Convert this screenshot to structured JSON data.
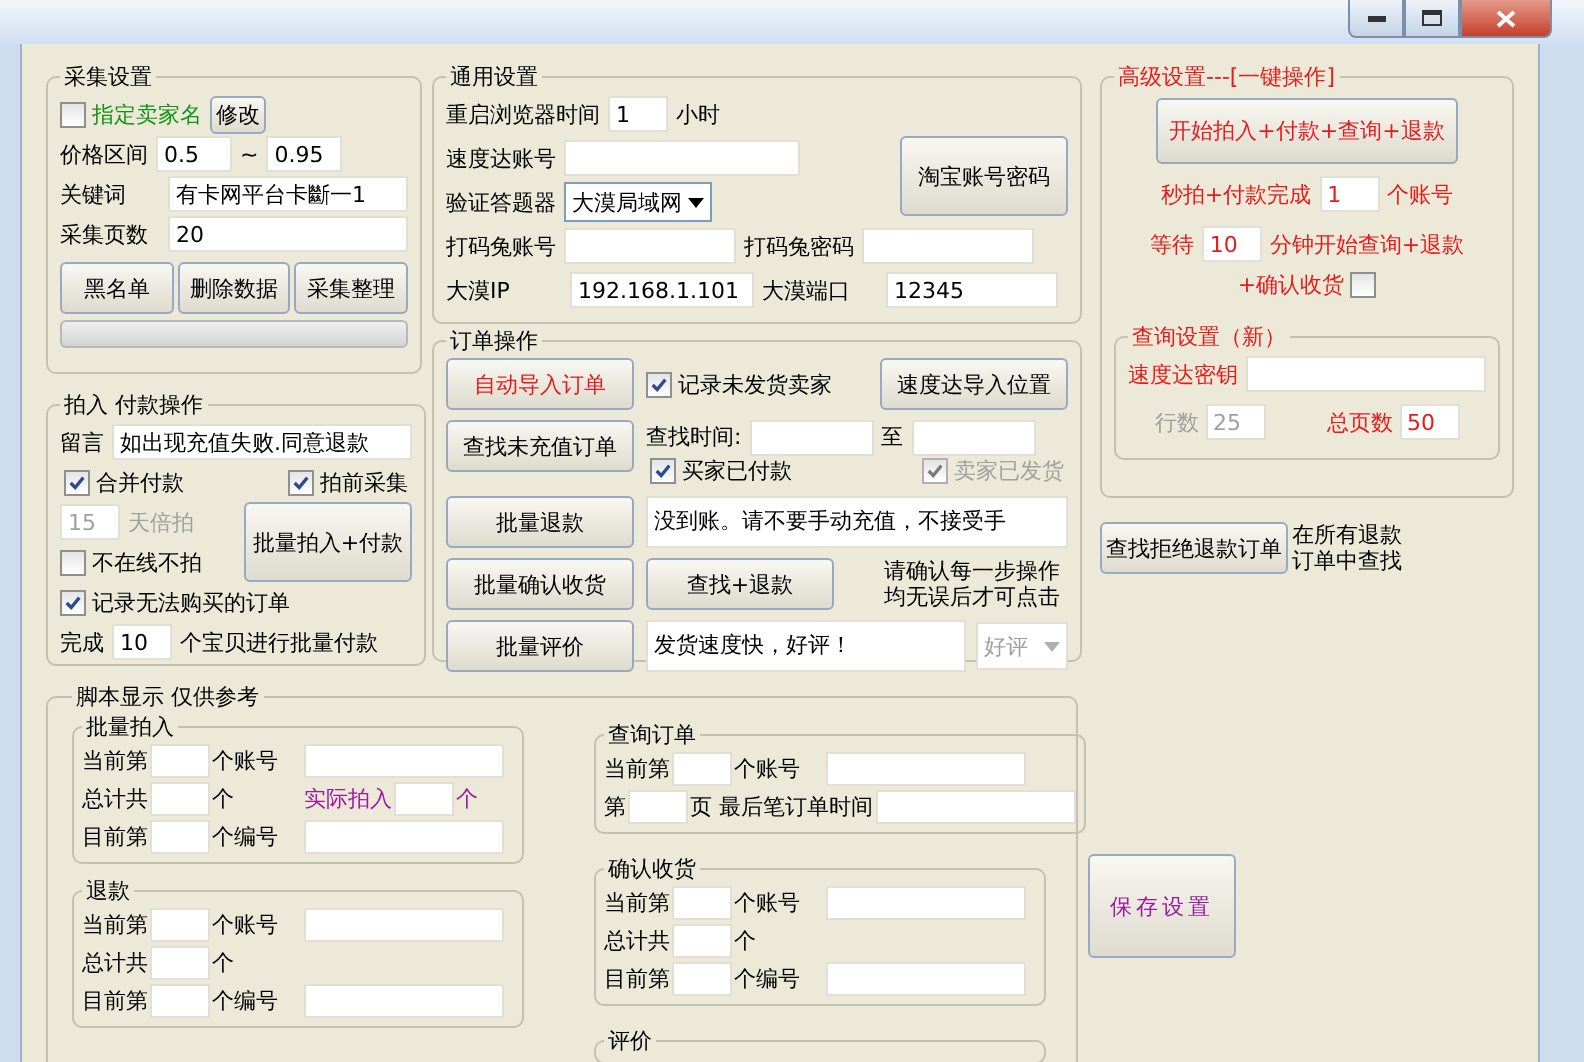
{
  "collect_settings": {
    "title": "采集设置",
    "seller_name": {
      "label": "指定卖家名",
      "checked": false
    },
    "modify_button": "修改",
    "price_label": "价格区间",
    "price_min": "0.5",
    "price_sep": "~",
    "price_max": "0.95",
    "keyword_label": "关键词",
    "keyword": "有卡网平台卡斷一1",
    "pages_label": "采集页数",
    "pages": "20",
    "buttons": [
      "黑名单",
      "删除数据",
      "采集整理"
    ],
    "progress": {
      "level": 0
    }
  },
  "buy_pay": {
    "title": "拍入 付款操作",
    "message_label": "留言",
    "message": "如出现充值失败.同意退款",
    "merge_pay": {
      "label": "合并付款",
      "checked": true
    },
    "pre_collect": {
      "label": "拍前采集",
      "checked": true
    },
    "days": {
      "value": "15",
      "label": "天倍拍",
      "disabled": true
    },
    "offline": {
      "label": "不在线不拍",
      "checked": false
    },
    "batch_button": "批量拍入+付款",
    "record": {
      "label": "记录无法购买的订单",
      "checked": true
    },
    "done_prefix": "完成",
    "done_count": "10",
    "done_suffix": "个宝贝进行批量付款"
  },
  "general": {
    "title": "通用设置",
    "restart_label": "重启浏览器时间",
    "restart_value": "1",
    "restart_unit": "小时",
    "sdd_account_label": "速度达账号",
    "captcha_label": "验证答题器",
    "captcha_value": "大漠局域网",
    "taobao_button": "淘宝账号密码",
    "dama_account_label": "打码兔账号",
    "dama_password_label": "打码兔密码",
    "dm_ip_label": "大漠IP",
    "dm_ip": "192.168.1.101",
    "dm_port_label": "大漠端口",
    "dm_port": "12345"
  },
  "orders": {
    "title": "订单操作",
    "auto_import_button": "自动导入订单",
    "record_unshipped": {
      "label": "记录未发货卖家",
      "checked": true
    },
    "sdd_import_button": "速度达导入位置",
    "find_unpaid_button": "查找未充值订单",
    "find_time_label": "查找时间:",
    "to_label": "至",
    "buyer_paid": {
      "label": "买家已付款",
      "checked": true,
      "disabled": false
    },
    "seller_shipped": {
      "label": "卖家已发货",
      "checked": true,
      "disabled": true
    },
    "refund_button": "批量退款",
    "refund_message": "没到账。请不要手动充值，不接受手",
    "confirm_button": "批量确认收货",
    "find_refund_button": "查找+退款",
    "note": "请确认每一步操作均无误后才可点击",
    "review_button": "批量评价",
    "review_message": "发货速度快，好评！",
    "review_type": {
      "value": "好评",
      "disabled": true
    }
  },
  "advanced": {
    "title": "高级设置---[一键操作]",
    "start_button": "开始拍入+付款+查询+退款",
    "sec_label": "秒拍+付款完成",
    "sec_value": "1",
    "sec_unit": "个账号",
    "wait_label": "等待",
    "wait_value": "10",
    "wait_unit": "分钟开始查询+退款",
    "confirm": {
      "label": "+确认收货",
      "checked": false
    },
    "query": {
      "title": "查询设置（新）",
      "key_label": "速度达密钥",
      "rows": {
        "label": "行数",
        "value": "25",
        "disabled": true
      },
      "pages_label": "总页数",
      "pages_value": "50"
    }
  },
  "find_rejected": {
    "button": "查找拒绝退款订单",
    "note": "在所有退款订单中查找"
  },
  "script_display": {
    "title": "脚本显示 仅供参考",
    "left_groups": [
      {
        "title": "批量拍入",
        "rows": [
          [
            {
              "kind": "label",
              "text": "当前第"
            },
            {
              "kind": "short-field"
            },
            {
              "kind": "unit",
              "text": "个账号"
            },
            {
              "kind": "long-field"
            }
          ],
          [
            {
              "kind": "label",
              "text": "总计共"
            },
            {
              "kind": "short-field"
            },
            {
              "kind": "unit",
              "text": "个"
            },
            {
              "kind": "accent",
              "text": "实际拍入"
            },
            {
              "kind": "short-field"
            },
            {
              "kind": "accent",
              "text": "个"
            }
          ],
          [
            {
              "kind": "label",
              "text": "目前第"
            },
            {
              "kind": "short-field"
            },
            {
              "kind": "unit",
              "text": "个编号"
            },
            {
              "kind": "long-field"
            }
          ]
        ]
      },
      {
        "title": "退款",
        "rows": [
          [
            {
              "kind": "label",
              "text": "当前第"
            },
            {
              "kind": "short-field"
            },
            {
              "kind": "unit",
              "text": "个账号"
            },
            {
              "kind": "long-field"
            }
          ],
          [
            {
              "kind": "label",
              "text": "总计共"
            },
            {
              "kind": "short-field"
            },
            {
              "kind": "unit",
              "text": "个"
            }
          ],
          [
            {
              "kind": "label",
              "text": "目前第"
            },
            {
              "kind": "short-field"
            },
            {
              "kind": "unit",
              "text": "个编号"
            },
            {
              "kind": "long-field"
            }
          ]
        ]
      }
    ],
    "right_groups": [
      {
        "title": "查询订单",
        "rows": [
          [
            {
              "kind": "label",
              "text": "当前第"
            },
            {
              "kind": "short-field"
            },
            {
              "kind": "unit",
              "text": "个账号"
            },
            {
              "kind": "long-field"
            }
          ],
          [
            {
              "kind": "label",
              "text": "第"
            },
            {
              "kind": "short-field"
            },
            {
              "kind": "label",
              "text": "页 最后笔订单时间"
            },
            {
              "kind": "long-field"
            }
          ]
        ]
      },
      {
        "title": "确认收货",
        "rows": [
          [
            {
              "kind": "label",
              "text": "当前第"
            },
            {
              "kind": "short-field"
            },
            {
              "kind": "unit",
              "text": "个账号"
            },
            {
              "kind": "long-field"
            }
          ],
          [
            {
              "kind": "label",
              "text": "总计共"
            },
            {
              "kind": "short-field"
            },
            {
              "kind": "unit",
              "text": "个"
            }
          ],
          [
            {
              "kind": "label",
              "text": "目前第"
            },
            {
              "kind": "short-field"
            },
            {
              "kind": "unit",
              "text": "个编号"
            },
            {
              "kind": "long-field"
            }
          ]
        ]
      },
      {
        "title": "评价"
      }
    ]
  },
  "save_button": "保存设置"
}
